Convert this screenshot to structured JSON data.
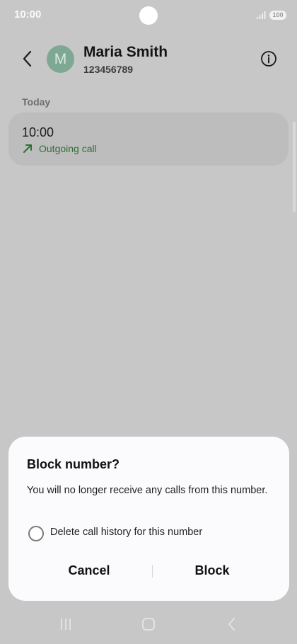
{
  "status_bar": {
    "time": "10:00",
    "battery": "100"
  },
  "contact": {
    "initial": "M",
    "name": "Maria Smith",
    "number": "123456789"
  },
  "history": {
    "section_label": "Today",
    "calls": [
      {
        "time": "10:00",
        "type": "Outgoing call"
      }
    ]
  },
  "dialog": {
    "title": "Block number?",
    "message": "You will no longer receive any calls from this number.",
    "checkbox_label": "Delete call history for this number",
    "checkbox_checked": false,
    "cancel_label": "Cancel",
    "confirm_label": "Block"
  },
  "colors": {
    "avatar": "#7ea894",
    "outgoing": "#2f7038",
    "dim_background": "#c7c7c7"
  },
  "icons": [
    "back-arrow-icon",
    "info-icon",
    "outgoing-call-arrow-icon",
    "recents-icon",
    "home-icon",
    "nav-back-icon"
  ]
}
